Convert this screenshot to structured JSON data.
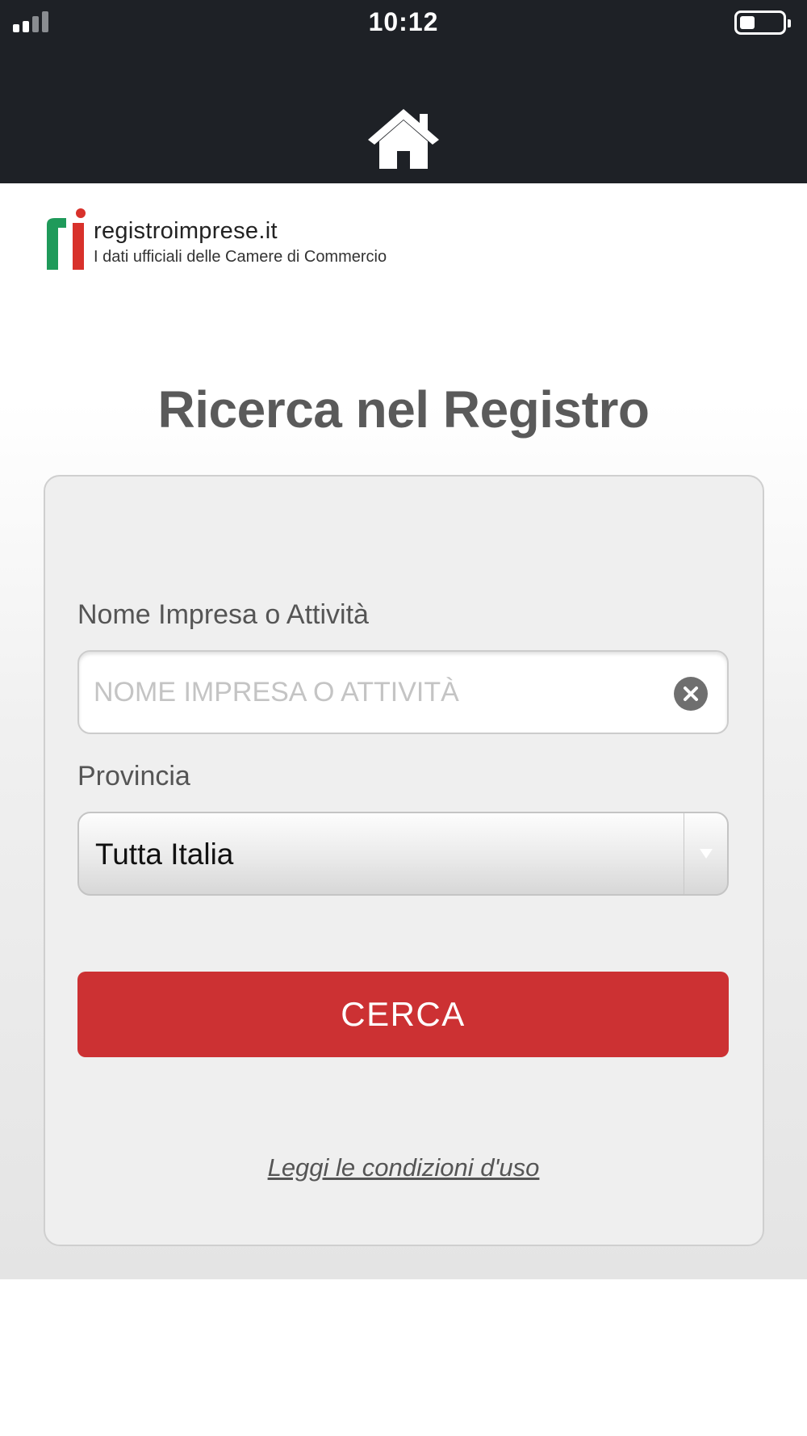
{
  "status_bar": {
    "time": "10:12",
    "battery_level": 0.35,
    "signal_bars_active": 2,
    "signal_bars_total": 4
  },
  "nav": {
    "home_icon": "home-icon"
  },
  "brand": {
    "name": "registroimprese.it",
    "tagline": "I dati ufficiali delle Camere di Commercio",
    "logo_colors": {
      "green": "#1f9a5a",
      "red": "#d8312b"
    }
  },
  "page": {
    "title": "Ricerca nel Registro"
  },
  "form": {
    "name_label": "Nome Impresa o Attività",
    "name_placeholder": "NOME IMPRESA O ATTIVITÀ",
    "name_value": "",
    "clear_icon": "clear-icon",
    "province_label": "Provincia",
    "province_value": "Tutta Italia",
    "province_arrow_icon": "chevron-down-icon",
    "submit_label": "CERCA",
    "terms_link": "Leggi le condizioni d'uso"
  },
  "colors": {
    "header_bg": "#1e2126",
    "accent_red": "#cc3133",
    "title_gray": "#5a5a5a"
  }
}
